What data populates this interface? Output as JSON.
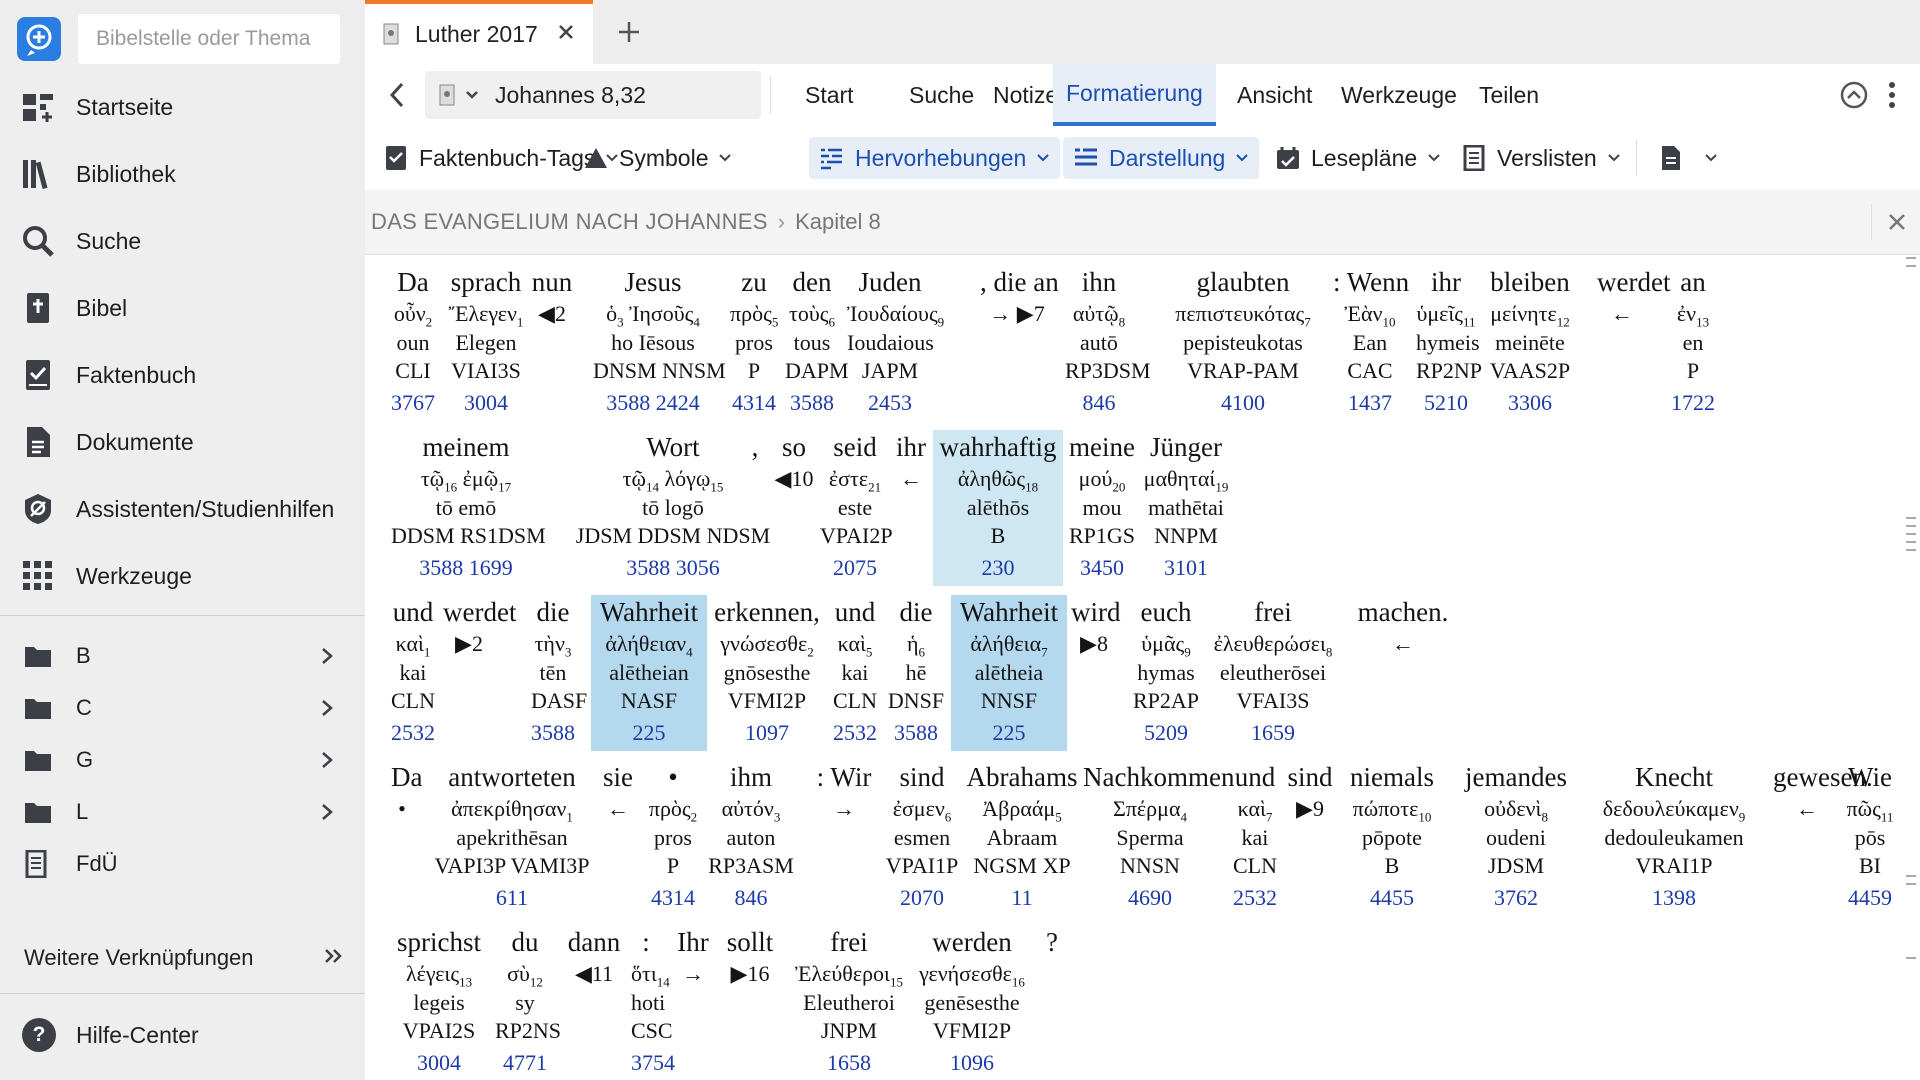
{
  "sidebar": {
    "search_placeholder": "Bibelstelle oder Thema",
    "nav": [
      {
        "label": "Startseite",
        "icon": "dashboard-icon"
      },
      {
        "label": "Bibliothek",
        "icon": "library-icon"
      },
      {
        "label": "Suche",
        "icon": "search-icon"
      },
      {
        "label": "Bibel",
        "icon": "bible-icon"
      },
      {
        "label": "Faktenbuch",
        "icon": "factbook-icon"
      },
      {
        "label": "Dokumente",
        "icon": "document-icon"
      },
      {
        "label": "Assistenten/Studienhilfen",
        "icon": "guides-icon"
      },
      {
        "label": "Werkzeuge",
        "icon": "tools-grid-icon"
      }
    ],
    "folders": [
      {
        "label": "B"
      },
      {
        "label": "C"
      },
      {
        "label": "G"
      },
      {
        "label": "L"
      },
      {
        "label": "FdÜ"
      }
    ],
    "more_links": "Weitere Verknüpfungen",
    "help": "Hilfe-Center"
  },
  "tab": {
    "title": "Luther 2017"
  },
  "navbar": {
    "reference": "Johannes 8,32",
    "menu": [
      "Start",
      "Suche",
      "Notizen",
      "Formatierung",
      "Ansicht",
      "Werkzeuge",
      "Teilen"
    ],
    "active": "Formatierung"
  },
  "toolbar": {
    "items": [
      "Faktenbuch-Tags",
      "Symbole",
      "Hervorhebungen",
      "Darstellung",
      "Lesepläne",
      "Verslisten"
    ]
  },
  "breadcrumb": {
    "book": "DAS EVANGELIUM NACH JOHANNES",
    "chapter": "Kapitel 8"
  },
  "colors": {
    "accent": "#2f6fd6",
    "highlight": "#cfe6f3",
    "strongs": "#1c3aa8",
    "tab_accent": "#f07a2c"
  },
  "interlinear": [
    [
      {
        "de": "Da",
        "gr": "οὖν",
        "n": "2",
        "tr": "oun",
        "mo": "CLI",
        "st": "3767"
      },
      {
        "de": "sprach",
        "gr": "Ἔλεγεν",
        "n": "1",
        "tr": "Elegen",
        "mo": "VIAI3S",
        "st": "3004"
      },
      {
        "de": "nun",
        "gr": "◀2",
        "n": "",
        "tr": "",
        "mo": "",
        "st": ""
      },
      {
        "de": "Jesus",
        "gr": "ὁ Ἰησοῦς",
        "n": "3 4",
        "tr": "ho Iēsous",
        "mo": "DNSM NNSM",
        "st": "3588 2424"
      },
      {
        "de": "zu",
        "gr": "πρὸς",
        "n": "5",
        "tr": "pros",
        "mo": "P",
        "st": "4314"
      },
      {
        "de": "den",
        "gr": "τοὺς",
        "n": "6",
        "tr": "tous",
        "mo": "DAPM",
        "st": "3588"
      },
      {
        "de": "Juden",
        "gr": "Ἰουδαίους",
        "n": "9",
        "tr": "Ioudaious",
        "mo": "JAPM",
        "st": "2453"
      },
      {
        "de": ", die an",
        "gr": "→ ▶7",
        "n": "",
        "tr": "",
        "mo": "",
        "st": ""
      },
      {
        "de": "ihn",
        "gr": "αὐτῷ",
        "n": "8",
        "tr": "autō",
        "mo": "RP3DSM",
        "st": "846"
      },
      {
        "de": "glaubten",
        "gr": "πεπιστευκότας",
        "n": "7",
        "tr": "pepisteukotas",
        "mo": "VRAP-PAM",
        "st": "4100"
      },
      {
        "de": ": Wenn",
        "gr": "Ἐὰν",
        "n": "10",
        "tr": "Ean",
        "mo": "CAC",
        "st": "1437"
      },
      {
        "de": "ihr",
        "gr": "ὑμεῖς",
        "n": "11",
        "tr": "hymeis",
        "mo": "RP2NP",
        "st": "5210"
      },
      {
        "de": "bleiben",
        "gr": "μείνητε",
        "n": "12",
        "tr": "meinēte",
        "mo": "VAAS2P",
        "st": "3306"
      },
      {
        "de": "werdet",
        "gr": "←",
        "n": "",
        "tr": "",
        "mo": "",
        "st": ""
      },
      {
        "de": "an",
        "gr": "ἐν",
        "n": "13",
        "tr": "en",
        "mo": "P",
        "st": "1722"
      }
    ],
    [
      {
        "de": "meinem",
        "gr": "τῷ ἐμῷ",
        "n": "16 17",
        "tr": "tō emō",
        "mo": "DDSM RS1DSM",
        "st": "3588 1699"
      },
      {
        "de": "Wort",
        "gr": "τῷ λόγῳ",
        "n": "14 15",
        "tr": "tō logō",
        "mo": "JDSM DDSM NDSM",
        "st": "3588 3056"
      },
      {
        "de": ",",
        "gr": "",
        "n": "",
        "tr": "",
        "mo": "",
        "st": ""
      },
      {
        "de": "so",
        "gr": "◀10",
        "n": "",
        "tr": "",
        "mo": "",
        "st": ""
      },
      {
        "de": "seid",
        "gr": "ἐστε",
        "n": "21",
        "tr": "este",
        "mo": "VPAI2P",
        "st": "2075"
      },
      {
        "de": "ihr",
        "gr": "←",
        "n": "",
        "tr": "",
        "mo": "",
        "st": ""
      },
      {
        "de": "wahrhaftig",
        "gr": "ἀληθῶς",
        "n": "18",
        "tr": "alēthōs",
        "mo": "B",
        "st": "230"
      },
      {
        "de": "meine",
        "gr": "μού",
        "n": "20",
        "tr": "mou",
        "mo": "RP1GS",
        "st": "3450"
      },
      {
        "de": "Jünger",
        "gr": "μαθηταί",
        "n": "19",
        "tr": "mathētai",
        "mo": "NNPM",
        "st": "3101"
      }
    ],
    [
      {
        "de": "und",
        "gr": "καὶ",
        "n": "1",
        "tr": "kai",
        "mo": "CLN",
        "st": "2532"
      },
      {
        "de": "werdet",
        "gr": "▶2",
        "n": "",
        "tr": "",
        "mo": "",
        "st": ""
      },
      {
        "de": "die",
        "gr": "τὴν",
        "n": "3",
        "tr": "tēn",
        "mo": "DASF",
        "st": "3588"
      },
      {
        "de": "Wahrheit",
        "gr": "ἀλήθειαν",
        "n": "4",
        "tr": "alētheian",
        "mo": "NASF",
        "st": "225"
      },
      {
        "de": "erkennen,",
        "gr": "γνώσεσθε",
        "n": "2",
        "tr": "gnōsesthe",
        "mo": "VFMI2P",
        "st": "1097"
      },
      {
        "de": "und",
        "gr": "καὶ",
        "n": "5",
        "tr": "kai",
        "mo": "CLN",
        "st": "2532"
      },
      {
        "de": "die",
        "gr": "ἡ",
        "n": "6",
        "tr": "hē",
        "mo": "DNSF",
        "st": "3588"
      },
      {
        "de": "Wahrheit",
        "gr": "ἀλήθεια",
        "n": "7",
        "tr": "alētheia",
        "mo": "NNSF",
        "st": "225"
      },
      {
        "de": "wird",
        "gr": "▶8",
        "n": "",
        "tr": "",
        "mo": "",
        "st": ""
      },
      {
        "de": "euch",
        "gr": "ὑμᾶς",
        "n": "9",
        "tr": "hymas",
        "mo": "RP2AP",
        "st": "5209"
      },
      {
        "de": "frei",
        "gr": "ἐλευθερώσει",
        "n": "8",
        "tr": "eleutherōsei",
        "mo": "VFAI3S",
        "st": "1659"
      },
      {
        "de": "machen.",
        "gr": "←",
        "n": "",
        "tr": "",
        "mo": "",
        "st": ""
      }
    ],
    [
      {
        "de": "Da",
        "gr": "•",
        "n": "",
        "tr": "",
        "mo": "",
        "st": ""
      },
      {
        "de": "antworteten",
        "gr": "ἀπεκρίθησαν",
        "n": "1",
        "tr": "apekrithēsan",
        "mo": "VAPI3P VAMI3P",
        "st": "611"
      },
      {
        "de": "sie",
        "gr": "←",
        "n": "",
        "tr": "",
        "mo": "",
        "st": ""
      },
      {
        "de": "•",
        "gr": "πρὸς",
        "n": "2",
        "tr": "pros",
        "mo": "P",
        "st": "4314"
      },
      {
        "de": "ihm",
        "gr": "αὐτόν",
        "n": "3",
        "tr": "auton",
        "mo": "RP3ASM",
        "st": "846"
      },
      {
        "de": ": Wir",
        "gr": "→",
        "n": "",
        "tr": "",
        "mo": "",
        "st": ""
      },
      {
        "de": "sind",
        "gr": "ἐσμεν",
        "n": "6",
        "tr": "esmen",
        "mo": "VPAI1P",
        "st": "2070"
      },
      {
        "de": "Abrahams",
        "gr": "Ἀβραάμ",
        "n": "5",
        "tr": "Abraam",
        "mo": "NGSM XP",
        "st": "11"
      },
      {
        "de": "Nachkommen",
        "gr": "Σπέρμα",
        "n": "4",
        "tr": "Sperma",
        "mo": "NNSN",
        "st": "4690"
      },
      {
        "de": "und",
        "gr": "καὶ",
        "n": "7",
        "tr": "kai",
        "mo": "CLN",
        "st": "2532"
      },
      {
        "de": "sind",
        "gr": "▶9",
        "n": "",
        "tr": "",
        "mo": "",
        "st": ""
      },
      {
        "de": "niemals",
        "gr": "πώποτε",
        "n": "10",
        "tr": "pōpote",
        "mo": "B",
        "st": "4455"
      },
      {
        "de": "jemandes",
        "gr": "οὐδενὶ",
        "n": "8",
        "tr": "oudeni",
        "mo": "JDSM",
        "st": "3762"
      },
      {
        "de": "Knecht",
        "gr": "δεδουλεύκαμεν",
        "n": "9",
        "tr": "dedouleukamen",
        "mo": "VRAI1P",
        "st": "1398"
      },
      {
        "de": "gewesen.",
        "gr": "←",
        "n": "",
        "tr": "",
        "mo": "",
        "st": ""
      },
      {
        "de": "Wie",
        "gr": "πῶς",
        "n": "11",
        "tr": "pōs",
        "mo": "BI",
        "st": "4459"
      }
    ],
    [
      {
        "de": "sprichst",
        "gr": "λέγεις",
        "n": "13",
        "tr": "legeis",
        "mo": "VPAI2S",
        "st": "3004"
      },
      {
        "de": "du",
        "gr": "σὺ",
        "n": "12",
        "tr": "sy",
        "mo": "RP2NS",
        "st": "4771"
      },
      {
        "de": "dann",
        "gr": "◀11",
        "n": "",
        "tr": "",
        "mo": "",
        "st": ""
      },
      {
        "de": ":",
        "gr": "ὅτι",
        "n": "14",
        "tr": "hoti",
        "mo": "CSC",
        "st": "3754"
      },
      {
        "de": "Ihr",
        "gr": "→",
        "n": "",
        "tr": "",
        "mo": "",
        "st": ""
      },
      {
        "de": "sollt",
        "gr": "▶16",
        "n": "",
        "tr": "",
        "mo": "",
        "st": ""
      },
      {
        "de": "frei",
        "gr": "Ἐλεύθεροι",
        "n": "15",
        "tr": "Eleutheroi",
        "mo": "JNPM",
        "st": "1658"
      },
      {
        "de": "werden",
        "gr": "γενήσεσθε",
        "n": "16",
        "tr": "genēsesthe",
        "mo": "VFMI2P",
        "st": "1096"
      },
      {
        "de": "?",
        "gr": "",
        "n": "",
        "tr": "",
        "mo": "",
        "st": ""
      }
    ]
  ]
}
